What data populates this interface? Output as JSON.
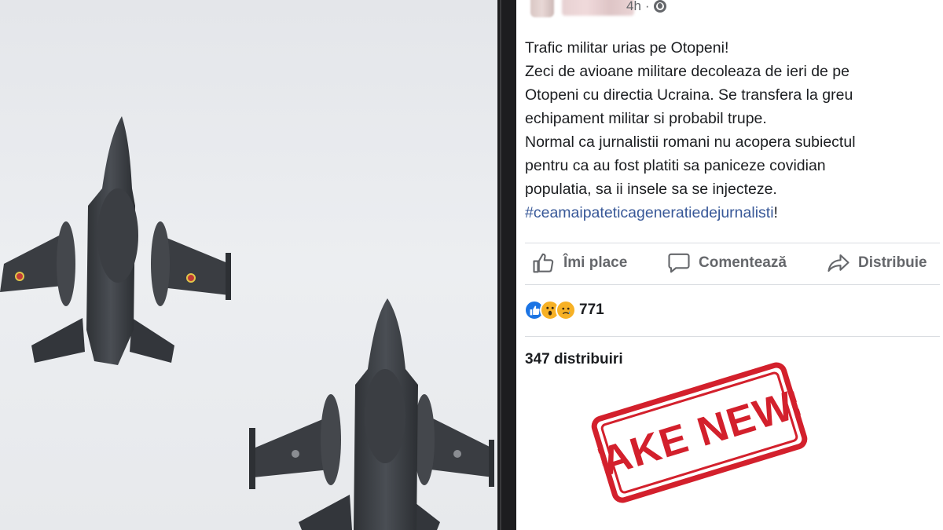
{
  "post": {
    "time": "4h",
    "lines": [
      "Trafic militar urias pe Otopeni!",
      "Zeci de avioane militare decoleaza de ieri de pe",
      "Otopeni cu directia Ucraina. Se transfera la greu",
      "echipament militar si probabil trupe.",
      "Normal ca jurnalistii romani nu acopera subiectul",
      "pentru ca au fost platiti sa paniceze covidian",
      "populatia, sa ii insele sa se injecteze."
    ],
    "hashtag": "#ceamaipateticageneratiedejurnalisti",
    "hashtag_suffix": "!"
  },
  "actions": {
    "like_label": "Îmi place",
    "comment_label": "Comentează",
    "share_label": "Distribuie"
  },
  "stats": {
    "reactions_count": "771",
    "shares_text": "347 distribuiri"
  },
  "stamp": {
    "text": "FAKE NEWS",
    "color": "#d3202c"
  },
  "icons": {
    "like": "thumbs-up-icon",
    "comment": "speech-bubble-icon",
    "share": "share-arrow-icon",
    "audience": "globe-icon"
  }
}
